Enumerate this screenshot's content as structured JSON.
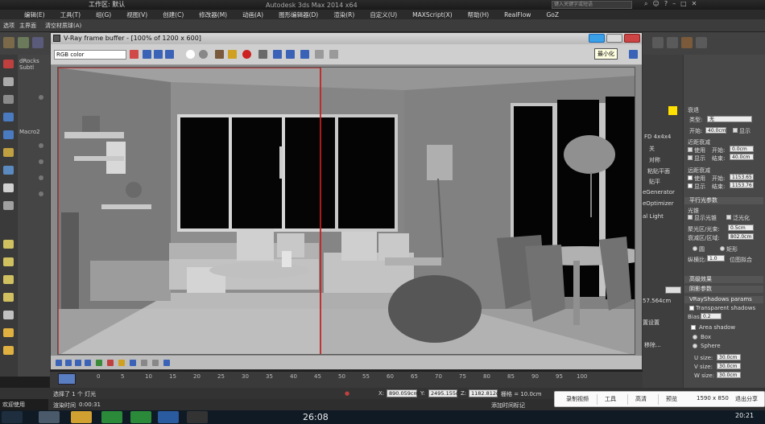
{
  "app": {
    "window_title": "Autodesk 3ds Max 2014 x64",
    "workspace_label": "工作区: 默认",
    "search_placeholder": "键入关键字或短语"
  },
  "menu": [
    "编辑(E)",
    "工具(T)",
    "组(G)",
    "视图(V)",
    "创建(C)",
    "修改器(M)",
    "动画(A)",
    "图形编辑器(D)",
    "渲染(R)",
    "自定义(U)",
    "MAXScript(X)",
    "帮助(H)",
    "RealFlow",
    "GoZ"
  ],
  "ribbon_tabs": [
    "选项",
    "主界面",
    "清空材质球(A)"
  ],
  "left_panel": {
    "tab_label": "dRocks Subtl",
    "macro_label": "Macro2"
  },
  "vfb": {
    "title": "V-Ray frame buffer - [100% of 1200 x 600]",
    "channel": "RGB color",
    "tooltip": "最小化"
  },
  "right_panel": {
    "section_far": "衰退",
    "type_label": "类型:",
    "type_value": "无",
    "start_label": "开始:",
    "start_value": "40.0cm",
    "show_label": "显示",
    "near_atten_head": "近距衰减",
    "near_use": "使用",
    "near_start_label": "开始:",
    "near_start": "0.0cm",
    "near_show": "显示",
    "near_end_label": "结束:",
    "near_end": "40.0cm",
    "far_atten_head": "远距衰减",
    "far_use": "使用",
    "far_start_label": "开始:",
    "far_start": "1153.65",
    "far_show": "显示",
    "far_end_label": "结束:",
    "far_end": "1153.76",
    "parallel_head": "平行光参数",
    "cone_label": "光锥",
    "overshoot": "显示光锥",
    "overshoot2": "泛光化",
    "hotspot_label": "聚光区/光束:",
    "hotspot": "0.5cm",
    "falloff_label": "衰减区/区域:",
    "falloff": "802.0cm",
    "circle": "圆",
    "rect": "矩形",
    "aspect_label": "纵横比:",
    "aspect": "1.0",
    "bitmap_fit": "位图拟合",
    "advanced": "高级效果",
    "shadow_params": "阴影参数",
    "vray_shadows": "VRayShadows params",
    "transparent_shadows": "Transparent shadows",
    "bias_label": "Bias:",
    "bias": "0.2",
    "area_shadow": "Area shadow",
    "box": "Box",
    "sphere": "Sphere",
    "usize_label": "U size:",
    "usize": "30.0cm",
    "vsize_label": "V size:",
    "vsize": "30.0cm",
    "wsize_label": "W size:",
    "wsize": "30.0cm",
    "col1_items": [
      "FD 4x4x4",
      "关",
      "对称",
      "粘贴平面",
      "贴平",
      "ptimizer",
      "eGenerator",
      "eOptimizer"
    ],
    "light_name": "al Light",
    "col1_value": "57.564cm",
    "col1_set": "置设置",
    "col1_remove": "移除..."
  },
  "timeline": {
    "ticks": [
      "0",
      "5",
      "10",
      "15",
      "20",
      "25",
      "30",
      "35",
      "40",
      "45",
      "50",
      "55",
      "60",
      "65",
      "70",
      "75",
      "80",
      "85",
      "90",
      "95",
      "100"
    ]
  },
  "status": {
    "welcome": "欢迎使用 MAXScr",
    "selection": "选择了 1 个 灯光",
    "render_time_label": "渲染时间",
    "render_time": "0:00:31",
    "x_label": "X:",
    "x": "890.059cm",
    "y_label": "Y:",
    "y": "2495.155c",
    "z_label": "Z:",
    "z": "1182.812c",
    "grid": "栅格 = 10.0cm",
    "add_tag": "添加时间标记"
  },
  "recorder": {
    "record": "录制视频",
    "tools": "工具",
    "quality": "高清",
    "preview": "预览",
    "resolution": "1590 x 850",
    "exit_share": "退出分享"
  },
  "taskbar": {
    "clock": "26:08",
    "time": "20:21"
  }
}
